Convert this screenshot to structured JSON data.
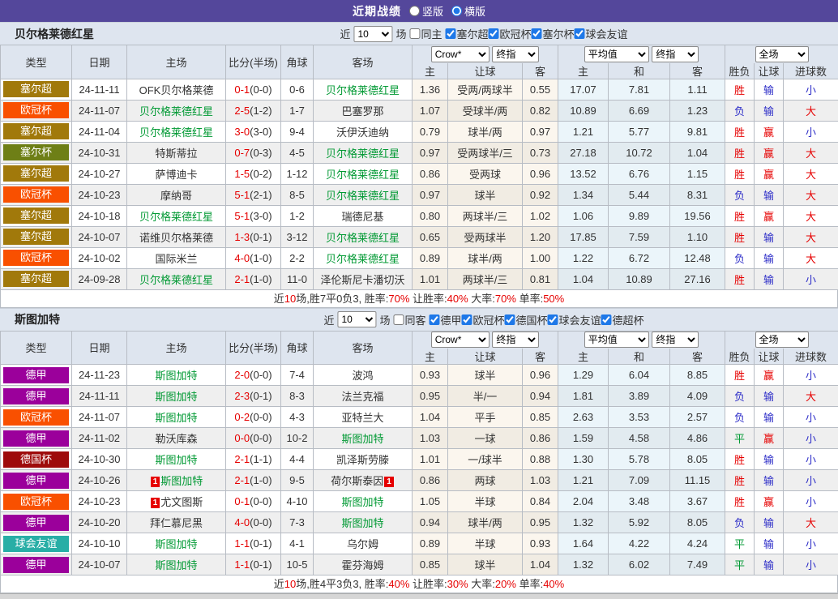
{
  "topbar": {
    "title": "近期战绩",
    "vertical_label": "竖版",
    "horizontal_label": "横版",
    "selected_layout": "横版",
    "bar_color": "#54479B"
  },
  "colors": {
    "win_red": "#E60000",
    "loss_blue": "#2E2EC8",
    "draw_green": "#009933",
    "team_highlight_green": "#009933",
    "check_accent": "#1E78E8",
    "header_bg": "#DEE5EF"
  },
  "type_colors": {
    "塞尔超": "#A1790B",
    "欧冠杯": "#F95000",
    "塞尔杯": "#6E7F16",
    "德甲": "#9B009B",
    "德国杯": "#9E0B0B",
    "球会友谊": "#28AEA6"
  },
  "sections": [
    {
      "team": "贝尔格莱德红星",
      "filter": {
        "near_label": "近",
        "count": "10",
        "games_label": "场",
        "same_label": "同主",
        "same_checked": false,
        "leagues": [
          "塞尔超",
          "欧冠杯",
          "塞尔杯",
          "球会友谊"
        ]
      },
      "header": {
        "cols": [
          "类型",
          "日期",
          "主场",
          "比分(半场)",
          "角球",
          "客场"
        ],
        "odds_company": "Crow*",
        "odds_period": "终指",
        "avg_source": "平均值",
        "avg_period": "终指",
        "scope": "全场",
        "sub_cols": [
          "主",
          "让球",
          "客",
          "主",
          "和",
          "客",
          "胜负",
          "让球",
          "进球数"
        ]
      },
      "rows": [
        {
          "type": "塞尔超",
          "date": "24-11-11",
          "home": "OFK贝尔格莱德",
          "home_green": false,
          "home_card": "",
          "score": "0-1",
          "half": "(0-0)",
          "corner": "0-6",
          "away": "贝尔格莱德红星",
          "away_green": true,
          "away_card": "",
          "odds": [
            "1.36",
            "受两/两球半",
            "0.55"
          ],
          "avg": [
            "17.07",
            "7.81",
            "1.11"
          ],
          "results": [
            [
              "胜",
              "r"
            ],
            [
              "输",
              "b"
            ],
            [
              "小",
              "b"
            ]
          ]
        },
        {
          "type": "欧冠杯",
          "date": "24-11-07",
          "home": "贝尔格莱德红星",
          "home_green": true,
          "home_card": "",
          "score": "2-5",
          "half": "(1-2)",
          "corner": "1-7",
          "away": "巴塞罗那",
          "away_green": false,
          "away_card": "",
          "odds": [
            "1.07",
            "受球半/两",
            "0.82"
          ],
          "avg": [
            "10.89",
            "6.69",
            "1.23"
          ],
          "results": [
            [
              "负",
              "b"
            ],
            [
              "输",
              "b"
            ],
            [
              "大",
              "r"
            ]
          ]
        },
        {
          "type": "塞尔超",
          "date": "24-11-04",
          "home": "贝尔格莱德红星",
          "home_green": true,
          "home_card": "",
          "score": "3-0",
          "half": "(3-0)",
          "corner": "9-4",
          "away": "沃伊沃迪纳",
          "away_green": false,
          "away_card": "",
          "odds": [
            "0.79",
            "球半/两",
            "0.97"
          ],
          "avg": [
            "1.21",
            "5.77",
            "9.81"
          ],
          "results": [
            [
              "胜",
              "r"
            ],
            [
              "赢",
              "r"
            ],
            [
              "小",
              "b"
            ]
          ]
        },
        {
          "type": "塞尔杯",
          "date": "24-10-31",
          "home": "特斯蒂拉",
          "home_green": false,
          "home_card": "",
          "score": "0-7",
          "half": "(0-3)",
          "corner": "4-5",
          "away": "贝尔格莱德红星",
          "away_green": true,
          "away_card": "",
          "odds": [
            "0.97",
            "受两球半/三",
            "0.73"
          ],
          "avg": [
            "27.18",
            "10.72",
            "1.04"
          ],
          "results": [
            [
              "胜",
              "r"
            ],
            [
              "赢",
              "r"
            ],
            [
              "大",
              "r"
            ]
          ]
        },
        {
          "type": "塞尔超",
          "date": "24-10-27",
          "home": "萨博迪卡",
          "home_green": false,
          "home_card": "",
          "score": "1-5",
          "half": "(0-2)",
          "corner": "1-12",
          "away": "贝尔格莱德红星",
          "away_green": true,
          "away_card": "",
          "odds": [
            "0.86",
            "受两球",
            "0.96"
          ],
          "avg": [
            "13.52",
            "6.76",
            "1.15"
          ],
          "results": [
            [
              "胜",
              "r"
            ],
            [
              "赢",
              "r"
            ],
            [
              "大",
              "r"
            ]
          ]
        },
        {
          "type": "欧冠杯",
          "date": "24-10-23",
          "home": "摩纳哥",
          "home_green": false,
          "home_card": "",
          "score": "5-1",
          "half": "(2-1)",
          "corner": "8-5",
          "away": "贝尔格莱德红星",
          "away_green": true,
          "away_card": "",
          "odds": [
            "0.97",
            "球半",
            "0.92"
          ],
          "avg": [
            "1.34",
            "5.44",
            "8.31"
          ],
          "results": [
            [
              "负",
              "b"
            ],
            [
              "输",
              "b"
            ],
            [
              "大",
              "r"
            ]
          ]
        },
        {
          "type": "塞尔超",
          "date": "24-10-18",
          "home": "贝尔格莱德红星",
          "home_green": true,
          "home_card": "",
          "score": "5-1",
          "half": "(3-0)",
          "corner": "1-2",
          "away": "瑞德尼基",
          "away_green": false,
          "away_card": "",
          "odds": [
            "0.80",
            "两球半/三",
            "1.02"
          ],
          "avg": [
            "1.06",
            "9.89",
            "19.56"
          ],
          "results": [
            [
              "胜",
              "r"
            ],
            [
              "赢",
              "r"
            ],
            [
              "大",
              "r"
            ]
          ]
        },
        {
          "type": "塞尔超",
          "date": "24-10-07",
          "home": "诺维贝尔格莱德",
          "home_green": false,
          "home_card": "",
          "score": "1-3",
          "half": "(0-1)",
          "corner": "3-12",
          "away": "贝尔格莱德红星",
          "away_green": true,
          "away_card": "",
          "odds": [
            "0.65",
            "受两球半",
            "1.20"
          ],
          "avg": [
            "17.85",
            "7.59",
            "1.10"
          ],
          "results": [
            [
              "胜",
              "r"
            ],
            [
              "输",
              "b"
            ],
            [
              "大",
              "r"
            ]
          ]
        },
        {
          "type": "欧冠杯",
          "date": "24-10-02",
          "home": "国际米兰",
          "home_green": false,
          "home_card": "",
          "score": "4-0",
          "half": "(1-0)",
          "corner": "2-2",
          "away": "贝尔格莱德红星",
          "away_green": true,
          "away_card": "",
          "odds": [
            "0.89",
            "球半/两",
            "1.00"
          ],
          "avg": [
            "1.22",
            "6.72",
            "12.48"
          ],
          "results": [
            [
              "负",
              "b"
            ],
            [
              "输",
              "b"
            ],
            [
              "大",
              "r"
            ]
          ]
        },
        {
          "type": "塞尔超",
          "date": "24-09-28",
          "home": "贝尔格莱德红星",
          "home_green": true,
          "home_card": "",
          "score": "2-1",
          "half": "(1-0)",
          "corner": "11-0",
          "away": "泽伦斯尼卡潘切沃",
          "away_green": false,
          "away_card": "",
          "odds": [
            "1.01",
            "两球半/三",
            "0.81"
          ],
          "avg": [
            "1.04",
            "10.89",
            "27.16"
          ],
          "results": [
            [
              "胜",
              "r"
            ],
            [
              "输",
              "b"
            ],
            [
              "小",
              "b"
            ]
          ]
        }
      ],
      "summary": [
        {
          "text": "近"
        },
        {
          "text": "10",
          "red": true
        },
        {
          "text": "场,胜7平0负3, 胜率:"
        },
        {
          "text": "70%",
          "red": true
        },
        {
          "text": " 让胜率:"
        },
        {
          "text": "40%",
          "red": true
        },
        {
          "text": " 大率:"
        },
        {
          "text": "70%",
          "red": true
        },
        {
          "text": " 单率:"
        },
        {
          "text": "50%",
          "red": true
        }
      ]
    },
    {
      "team": "斯图加特",
      "filter": {
        "near_label": "近",
        "count": "10",
        "games_label": "场",
        "same_label": "同客",
        "same_checked": false,
        "leagues": [
          "德甲",
          "欧冠杯",
          "德国杯",
          "球会友谊",
          "德超杯"
        ]
      },
      "header": {
        "cols": [
          "类型",
          "日期",
          "主场",
          "比分(半场)",
          "角球",
          "客场"
        ],
        "odds_company": "Crow*",
        "odds_period": "终指",
        "avg_source": "平均值",
        "avg_period": "终指",
        "scope": "全场",
        "sub_cols": [
          "主",
          "让球",
          "客",
          "主",
          "和",
          "客",
          "胜负",
          "让球",
          "进球数"
        ]
      },
      "rows": [
        {
          "type": "德甲",
          "date": "24-11-23",
          "home": "斯图加特",
          "home_green": true,
          "home_card": "",
          "score": "2-0",
          "half": "(0-0)",
          "corner": "7-4",
          "away": "波鸿",
          "away_green": false,
          "away_card": "",
          "odds": [
            "0.93",
            "球半",
            "0.96"
          ],
          "avg": [
            "1.29",
            "6.04",
            "8.85"
          ],
          "results": [
            [
              "胜",
              "r"
            ],
            [
              "赢",
              "r"
            ],
            [
              "小",
              "b"
            ]
          ]
        },
        {
          "type": "德甲",
          "date": "24-11-11",
          "home": "斯图加特",
          "home_green": true,
          "home_card": "",
          "score": "2-3",
          "half": "(0-1)",
          "corner": "8-3",
          "away": "法兰克福",
          "away_green": false,
          "away_card": "",
          "odds": [
            "0.95",
            "半/一",
            "0.94"
          ],
          "avg": [
            "1.81",
            "3.89",
            "4.09"
          ],
          "results": [
            [
              "负",
              "b"
            ],
            [
              "输",
              "b"
            ],
            [
              "大",
              "r"
            ]
          ]
        },
        {
          "type": "欧冠杯",
          "date": "24-11-07",
          "home": "斯图加特",
          "home_green": true,
          "home_card": "",
          "score": "0-2",
          "half": "(0-0)",
          "corner": "4-3",
          "away": "亚特兰大",
          "away_green": false,
          "away_card": "",
          "odds": [
            "1.04",
            "平手",
            "0.85"
          ],
          "avg": [
            "2.63",
            "3.53",
            "2.57"
          ],
          "results": [
            [
              "负",
              "b"
            ],
            [
              "输",
              "b"
            ],
            [
              "小",
              "b"
            ]
          ]
        },
        {
          "type": "德甲",
          "date": "24-11-02",
          "home": "勒沃库森",
          "home_green": false,
          "home_card": "",
          "score": "0-0",
          "half": "(0-0)",
          "corner": "10-2",
          "away": "斯图加特",
          "away_green": true,
          "away_card": "",
          "odds": [
            "1.03",
            "一球",
            "0.86"
          ],
          "avg": [
            "1.59",
            "4.58",
            "4.86"
          ],
          "results": [
            [
              "平",
              "g"
            ],
            [
              "赢",
              "r"
            ],
            [
              "小",
              "b"
            ]
          ]
        },
        {
          "type": "德国杯",
          "date": "24-10-30",
          "home": "斯图加特",
          "home_green": true,
          "home_card": "",
          "score": "2-1",
          "half": "(1-1)",
          "corner": "4-4",
          "away": "凯泽斯劳滕",
          "away_green": false,
          "away_card": "",
          "odds": [
            "1.01",
            "一/球半",
            "0.88"
          ],
          "avg": [
            "1.30",
            "5.78",
            "8.05"
          ],
          "results": [
            [
              "胜",
              "r"
            ],
            [
              "输",
              "b"
            ],
            [
              "小",
              "b"
            ]
          ]
        },
        {
          "type": "德甲",
          "date": "24-10-26",
          "home": "斯图加特",
          "home_green": true,
          "home_card": "1",
          "score": "2-1",
          "half": "(1-0)",
          "corner": "9-5",
          "away": "荷尔斯泰因",
          "away_green": false,
          "away_card": "1",
          "odds": [
            "0.86",
            "两球",
            "1.03"
          ],
          "avg": [
            "1.21",
            "7.09",
            "11.15"
          ],
          "results": [
            [
              "胜",
              "r"
            ],
            [
              "输",
              "b"
            ],
            [
              "小",
              "b"
            ]
          ]
        },
        {
          "type": "欧冠杯",
          "date": "24-10-23",
          "home": "尤文图斯",
          "home_green": false,
          "home_card": "1",
          "score": "0-1",
          "half": "(0-0)",
          "corner": "4-10",
          "away": "斯图加特",
          "away_green": true,
          "away_card": "",
          "odds": [
            "1.05",
            "半球",
            "0.84"
          ],
          "avg": [
            "2.04",
            "3.48",
            "3.67"
          ],
          "results": [
            [
              "胜",
              "r"
            ],
            [
              "赢",
              "r"
            ],
            [
              "小",
              "b"
            ]
          ]
        },
        {
          "type": "德甲",
          "date": "24-10-20",
          "home": "拜仁慕尼黑",
          "home_green": false,
          "home_card": "",
          "score": "4-0",
          "half": "(0-0)",
          "corner": "7-3",
          "away": "斯图加特",
          "away_green": true,
          "away_card": "",
          "odds": [
            "0.94",
            "球半/两",
            "0.95"
          ],
          "avg": [
            "1.32",
            "5.92",
            "8.05"
          ],
          "results": [
            [
              "负",
              "b"
            ],
            [
              "输",
              "b"
            ],
            [
              "大",
              "r"
            ]
          ]
        },
        {
          "type": "球会友谊",
          "date": "24-10-10",
          "home": "斯图加特",
          "home_green": true,
          "home_card": "",
          "score": "1-1",
          "half": "(0-1)",
          "corner": "4-1",
          "away": "乌尔姆",
          "away_green": false,
          "away_card": "",
          "odds": [
            "0.89",
            "半球",
            "0.93"
          ],
          "avg": [
            "1.64",
            "4.22",
            "4.24"
          ],
          "results": [
            [
              "平",
              "g"
            ],
            [
              "输",
              "b"
            ],
            [
              "小",
              "b"
            ]
          ]
        },
        {
          "type": "德甲",
          "date": "24-10-07",
          "home": "斯图加特",
          "home_green": true,
          "home_card": "",
          "score": "1-1",
          "half": "(0-1)",
          "corner": "10-5",
          "away": "霍芬海姆",
          "away_green": false,
          "away_card": "",
          "odds": [
            "0.85",
            "球半",
            "1.04"
          ],
          "avg": [
            "1.32",
            "6.02",
            "7.49"
          ],
          "results": [
            [
              "平",
              "g"
            ],
            [
              "输",
              "b"
            ],
            [
              "小",
              "b"
            ]
          ]
        }
      ],
      "summary": [
        {
          "text": "近"
        },
        {
          "text": "10",
          "red": true
        },
        {
          "text": "场,胜4平3负3, 胜率:"
        },
        {
          "text": "40%",
          "red": true
        },
        {
          "text": " 让胜率:"
        },
        {
          "text": "30%",
          "red": true
        },
        {
          "text": " 大率:"
        },
        {
          "text": "20%",
          "red": true
        },
        {
          "text": " 单率:"
        },
        {
          "text": "40%",
          "red": true
        }
      ]
    }
  ]
}
